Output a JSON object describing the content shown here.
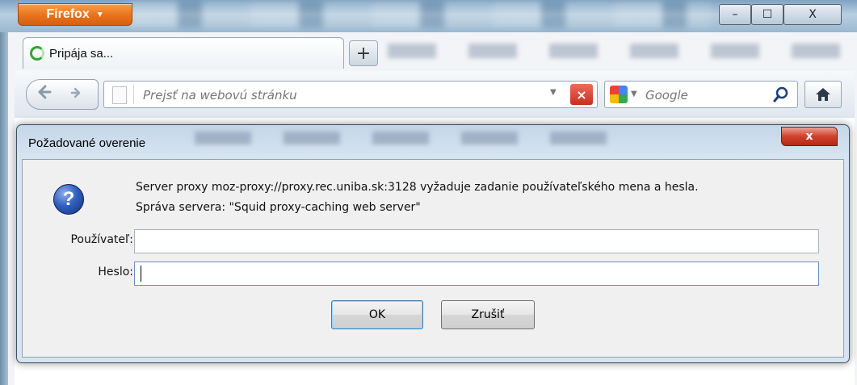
{
  "browser": {
    "menu_button": "Firefox",
    "window_controls": {
      "minimize": "–",
      "maximize": "☐",
      "close": "X"
    },
    "tab": {
      "label": "Pripája sa..."
    },
    "new_tab": "+",
    "urlbar": {
      "placeholder": "Prejsť na webovú stránku",
      "stop": "×"
    },
    "search": {
      "placeholder": "Google"
    }
  },
  "dialog": {
    "title": "Požadované overenie",
    "close": "x",
    "icon": "?",
    "message_line1": "Server proxy moz-proxy://proxy.rec.uniba.sk:3128 vyžaduje zadanie používateľského mena a hesla.",
    "message_line2": "Správa servera: \"Squid proxy-caching web server\"",
    "username_label": "Používateľ:",
    "username_value": "",
    "password_label": "Heslo:",
    "password_value": "",
    "ok_label": "OK",
    "cancel_label": "Zrušiť"
  }
}
